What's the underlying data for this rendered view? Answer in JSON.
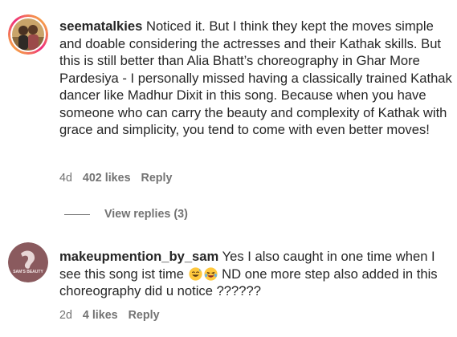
{
  "comments": [
    {
      "username": "seematalkies",
      "text": "Noticed it. But I think they kept the moves simple and doable considering the actresses and their Kathak skills. But this is still better than Alia Bhatt’s choreography in Ghar More Pardesiya - I personally missed having a classically trained Kathak dancer like Madhur Dixit in this song. Because when you have someone who can carry the beauty and complexity of Kathak with grace and simplicity, you tend to come with even better moves!",
      "age": "4d",
      "likes": "402 likes",
      "reply_label": "Reply",
      "view_replies": "View replies (3)"
    },
    {
      "username": "makeupmention_by_sam",
      "text_before_emoji": "Yes I also caught in one time when I see this song ist time ",
      "emojis": [
        "smiling-face-with-sweat-icon",
        "rolling-laughing-face-icon"
      ],
      "text_after_emoji": " ND one more step also added in this choreography did u notice ??????",
      "avatar_text": "SAM'S BEAUTY",
      "age": "2d",
      "likes": "4 likes",
      "reply_label": "Reply"
    }
  ],
  "colors": {
    "text": "#262626",
    "secondary": "#737373",
    "avatar_ring_start": "#f9ce34",
    "avatar_ring_end": "#ee2a7b",
    "avatar2_bg": "#8a5a5e"
  }
}
